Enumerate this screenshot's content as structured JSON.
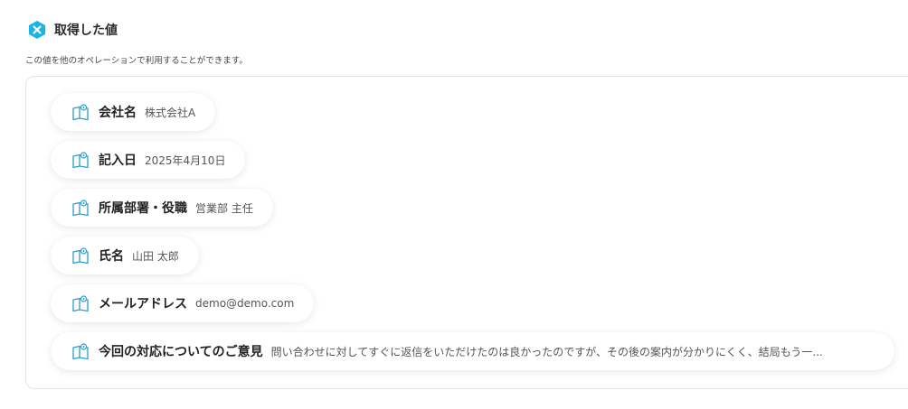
{
  "header": {
    "title": "取得した値",
    "description": "この値を他のオペレーションで利用することができます。",
    "icon": "yoom-hex-icon",
    "accent_color": "#1ab4e6"
  },
  "fields": [
    {
      "label": "会社名",
      "value": "株式会社A",
      "icon": "book-icon"
    },
    {
      "label": "記入日",
      "value": "2025年4月10日",
      "icon": "book-icon"
    },
    {
      "label": "所属部署・役職",
      "value": "営業部 主任",
      "icon": "book-icon"
    },
    {
      "label": "氏名",
      "value": "山田 太郎",
      "icon": "book-icon"
    },
    {
      "label": "メールアドレス",
      "value": "demo@demo.com",
      "icon": "book-icon"
    },
    {
      "label": "今回の対応についてのご意見",
      "value": "問い合わせに対してすぐに返信をいただけたのは良かったのですが、その後の案内が分かりにくく、結局もう一...",
      "icon": "book-icon"
    }
  ]
}
